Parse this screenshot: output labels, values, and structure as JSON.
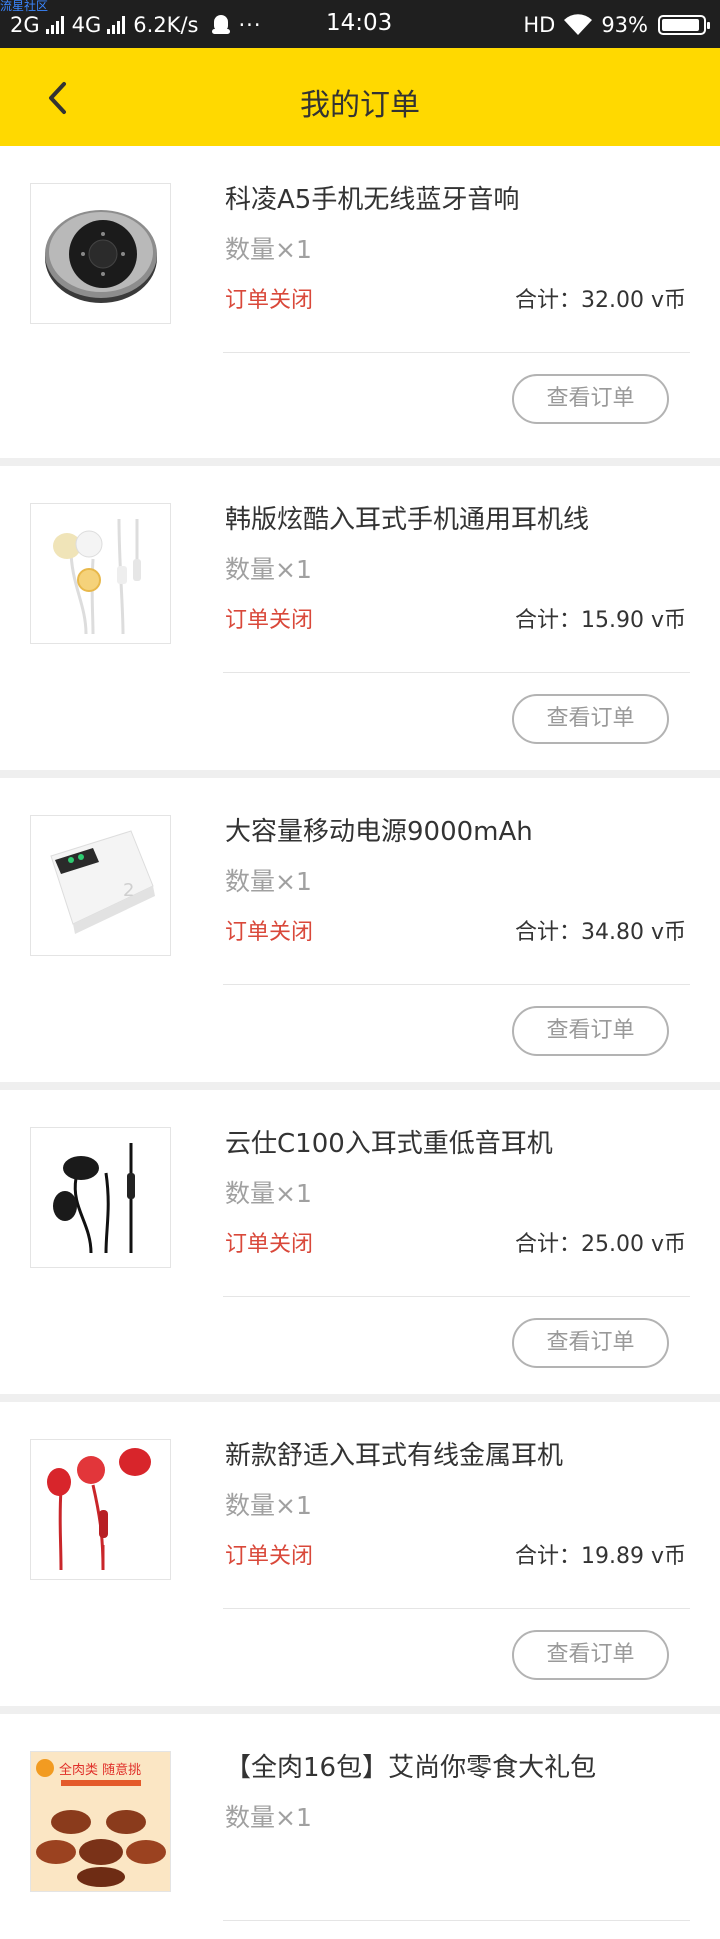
{
  "status_bar": {
    "watermark": "流星社区",
    "network1": "2G",
    "network2": "4G",
    "speed": "6.2K/s",
    "dots": "···",
    "time": "14:03",
    "hd": "HD",
    "battery": "93%"
  },
  "header": {
    "title": "我的订单",
    "color": "#ffd900"
  },
  "orders": [
    {
      "title": "科凌A5手机无线蓝牙音响",
      "quantity": "数量×1",
      "status": "订单关闭",
      "total": "合计：32.00 v币",
      "button": "查看订单"
    },
    {
      "title": "韩版炫酷入耳式手机通用耳机线",
      "quantity": "数量×1",
      "status": "订单关闭",
      "total": "合计：15.90 v币",
      "button": "查看订单"
    },
    {
      "title": "大容量移动电源9000mAh",
      "quantity": "数量×1",
      "status": "订单关闭",
      "total": "合计：34.80 v币",
      "button": "查看订单"
    },
    {
      "title": "云仕C100入耳式重低音耳机",
      "quantity": "数量×1",
      "status": "订单关闭",
      "total": "合计：25.00 v币",
      "button": "查看订单"
    },
    {
      "title": "新款舒适入耳式有线金属耳机",
      "quantity": "数量×1",
      "status": "订单关闭",
      "total": "合计：19.89 v币",
      "button": "查看订单"
    },
    {
      "title": "【全肉16包】艾尚你零食大礼包",
      "quantity": "数量×1"
    }
  ],
  "thumb_texts": {
    "snack_banner": "全肉类 随意挑"
  },
  "colors": {
    "status_red": "#d9483a",
    "accent_yellow": "#ffd900"
  }
}
